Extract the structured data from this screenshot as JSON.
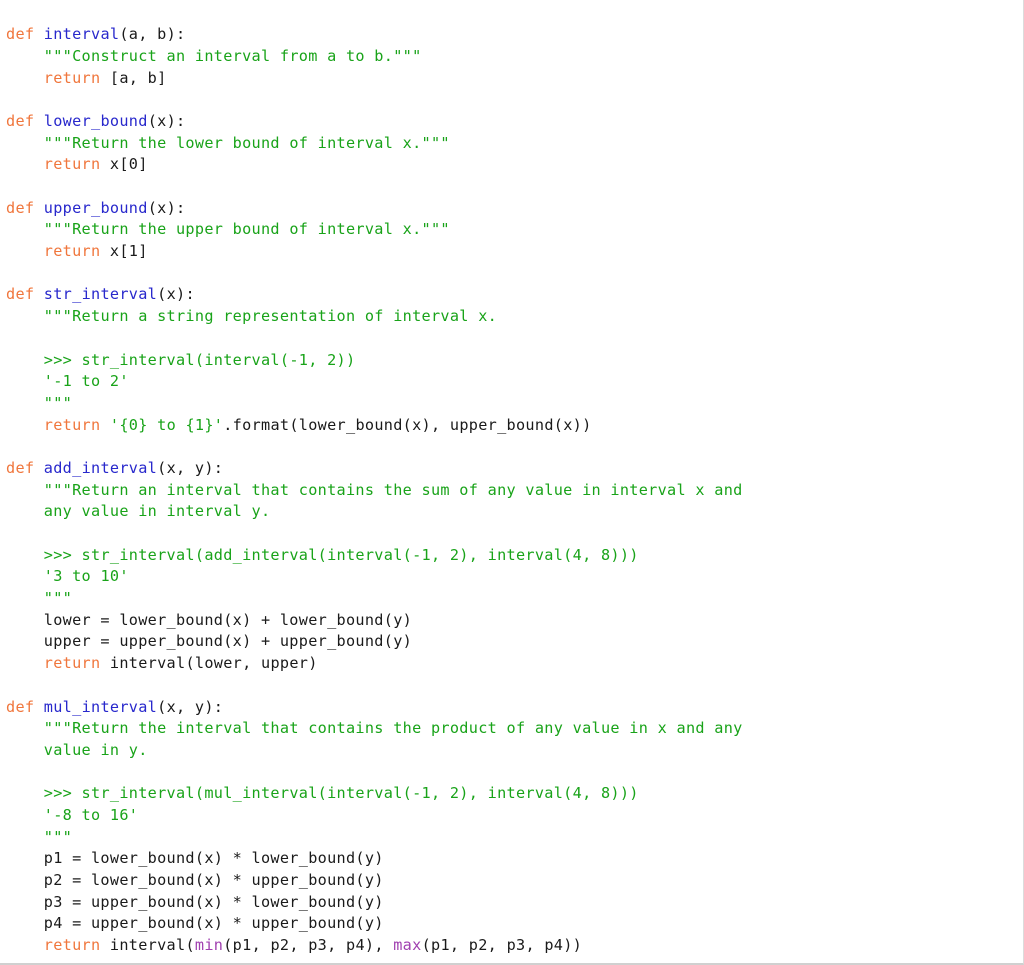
{
  "editor": {
    "language": "python",
    "colors": {
      "background": "#ffffff",
      "keyword": "#f0763c",
      "function_name": "#2828cc",
      "string": "#19a319",
      "builtin": "#a040b0",
      "plain": "#1a1a1a",
      "border": "#dcdcdc"
    },
    "line_count": 44
  },
  "code": {
    "lines": [
      {
        "n": 1,
        "tokens": [
          {
            "t": "kw",
            "s": "def"
          },
          {
            "t": "pl",
            "s": " "
          },
          {
            "t": "fn",
            "s": "interval"
          },
          {
            "t": "pl",
            "s": "(a, b):"
          }
        ]
      },
      {
        "n": 2,
        "tokens": [
          {
            "t": "pl",
            "s": "    "
          },
          {
            "t": "str",
            "s": "\"\"\"Construct an interval from a to b.\"\"\""
          }
        ]
      },
      {
        "n": 3,
        "tokens": [
          {
            "t": "pl",
            "s": "    "
          },
          {
            "t": "kw",
            "s": "return"
          },
          {
            "t": "pl",
            "s": " [a, b]"
          }
        ]
      },
      {
        "n": 4,
        "tokens": []
      },
      {
        "n": 5,
        "tokens": [
          {
            "t": "kw",
            "s": "def"
          },
          {
            "t": "pl",
            "s": " "
          },
          {
            "t": "fn",
            "s": "lower_bound"
          },
          {
            "t": "pl",
            "s": "(x):"
          }
        ]
      },
      {
        "n": 6,
        "tokens": [
          {
            "t": "pl",
            "s": "    "
          },
          {
            "t": "str",
            "s": "\"\"\"Return the lower bound of interval x.\"\"\""
          }
        ]
      },
      {
        "n": 7,
        "tokens": [
          {
            "t": "pl",
            "s": "    "
          },
          {
            "t": "kw",
            "s": "return"
          },
          {
            "t": "pl",
            "s": " x[0]"
          }
        ]
      },
      {
        "n": 8,
        "tokens": []
      },
      {
        "n": 9,
        "tokens": [
          {
            "t": "kw",
            "s": "def"
          },
          {
            "t": "pl",
            "s": " "
          },
          {
            "t": "fn",
            "s": "upper_bound"
          },
          {
            "t": "pl",
            "s": "(x):"
          }
        ]
      },
      {
        "n": 10,
        "tokens": [
          {
            "t": "pl",
            "s": "    "
          },
          {
            "t": "str",
            "s": "\"\"\"Return the upper bound of interval x.\"\"\""
          }
        ]
      },
      {
        "n": 11,
        "tokens": [
          {
            "t": "pl",
            "s": "    "
          },
          {
            "t": "kw",
            "s": "return"
          },
          {
            "t": "pl",
            "s": " x[1]"
          }
        ]
      },
      {
        "n": 12,
        "tokens": []
      },
      {
        "n": 13,
        "tokens": [
          {
            "t": "kw",
            "s": "def"
          },
          {
            "t": "pl",
            "s": " "
          },
          {
            "t": "fn",
            "s": "str_interval"
          },
          {
            "t": "pl",
            "s": "(x):"
          }
        ]
      },
      {
        "n": 14,
        "tokens": [
          {
            "t": "pl",
            "s": "    "
          },
          {
            "t": "str",
            "s": "\"\"\"Return a string representation of interval x."
          }
        ]
      },
      {
        "n": 15,
        "tokens": []
      },
      {
        "n": 16,
        "tokens": [
          {
            "t": "pl",
            "s": "    "
          },
          {
            "t": "str",
            "s": ">>> str_interval(interval(-1, 2))"
          }
        ]
      },
      {
        "n": 17,
        "tokens": [
          {
            "t": "pl",
            "s": "    "
          },
          {
            "t": "str",
            "s": "'-1 to 2'"
          }
        ]
      },
      {
        "n": 18,
        "tokens": [
          {
            "t": "pl",
            "s": "    "
          },
          {
            "t": "str",
            "s": "\"\"\""
          }
        ]
      },
      {
        "n": 19,
        "tokens": [
          {
            "t": "pl",
            "s": "    "
          },
          {
            "t": "kw",
            "s": "return"
          },
          {
            "t": "pl",
            "s": " "
          },
          {
            "t": "str",
            "s": "'{0} to {1}'"
          },
          {
            "t": "pl",
            "s": ".format(lower_bound(x), upper_bound(x))"
          }
        ]
      },
      {
        "n": 20,
        "tokens": []
      },
      {
        "n": 21,
        "tokens": [
          {
            "t": "kw",
            "s": "def"
          },
          {
            "t": "pl",
            "s": " "
          },
          {
            "t": "fn",
            "s": "add_interval"
          },
          {
            "t": "pl",
            "s": "(x, y):"
          }
        ]
      },
      {
        "n": 22,
        "tokens": [
          {
            "t": "pl",
            "s": "    "
          },
          {
            "t": "str",
            "s": "\"\"\"Return an interval that contains the sum of any value in interval x and"
          }
        ]
      },
      {
        "n": 23,
        "tokens": [
          {
            "t": "pl",
            "s": "    "
          },
          {
            "t": "str",
            "s": "any value in interval y."
          }
        ]
      },
      {
        "n": 24,
        "tokens": []
      },
      {
        "n": 25,
        "tokens": [
          {
            "t": "pl",
            "s": "    "
          },
          {
            "t": "str",
            "s": ">>> str_interval(add_interval(interval(-1, 2), interval(4, 8)))"
          }
        ]
      },
      {
        "n": 26,
        "tokens": [
          {
            "t": "pl",
            "s": "    "
          },
          {
            "t": "str",
            "s": "'3 to 10'"
          }
        ]
      },
      {
        "n": 27,
        "tokens": [
          {
            "t": "pl",
            "s": "    "
          },
          {
            "t": "str",
            "s": "\"\"\""
          }
        ]
      },
      {
        "n": 28,
        "tokens": [
          {
            "t": "pl",
            "s": "    lower = lower_bound(x) + lower_bound(y)"
          }
        ]
      },
      {
        "n": 29,
        "tokens": [
          {
            "t": "pl",
            "s": "    upper = upper_bound(x) + upper_bound(y)"
          }
        ]
      },
      {
        "n": 30,
        "tokens": [
          {
            "t": "pl",
            "s": "    "
          },
          {
            "t": "kw",
            "s": "return"
          },
          {
            "t": "pl",
            "s": " interval(lower, upper)"
          }
        ]
      },
      {
        "n": 31,
        "tokens": []
      },
      {
        "n": 32,
        "tokens": [
          {
            "t": "kw",
            "s": "def"
          },
          {
            "t": "pl",
            "s": " "
          },
          {
            "t": "fn",
            "s": "mul_interval"
          },
          {
            "t": "pl",
            "s": "(x, y):"
          }
        ]
      },
      {
        "n": 33,
        "tokens": [
          {
            "t": "pl",
            "s": "    "
          },
          {
            "t": "str",
            "s": "\"\"\"Return the interval that contains the product of any value in x and any"
          }
        ]
      },
      {
        "n": 34,
        "tokens": [
          {
            "t": "pl",
            "s": "    "
          },
          {
            "t": "str",
            "s": "value in y."
          }
        ]
      },
      {
        "n": 35,
        "tokens": []
      },
      {
        "n": 36,
        "tokens": [
          {
            "t": "pl",
            "s": "    "
          },
          {
            "t": "str",
            "s": ">>> str_interval(mul_interval(interval(-1, 2), interval(4, 8)))"
          }
        ]
      },
      {
        "n": 37,
        "tokens": [
          {
            "t": "pl",
            "s": "    "
          },
          {
            "t": "str",
            "s": "'-8 to 16'"
          }
        ]
      },
      {
        "n": 38,
        "tokens": [
          {
            "t": "pl",
            "s": "    "
          },
          {
            "t": "str",
            "s": "\"\"\""
          }
        ]
      },
      {
        "n": 39,
        "tokens": [
          {
            "t": "pl",
            "s": "    p1 = lower_bound(x) * lower_bound(y)"
          }
        ]
      },
      {
        "n": 40,
        "tokens": [
          {
            "t": "pl",
            "s": "    p2 = lower_bound(x) * upper_bound(y)"
          }
        ]
      },
      {
        "n": 41,
        "tokens": [
          {
            "t": "pl",
            "s": "    p3 = upper_bound(x) * lower_bound(y)"
          }
        ]
      },
      {
        "n": 42,
        "tokens": [
          {
            "t": "pl",
            "s": "    p4 = upper_bound(x) * upper_bound(y)"
          }
        ]
      },
      {
        "n": 43,
        "tokens": [
          {
            "t": "pl",
            "s": "    "
          },
          {
            "t": "kw",
            "s": "return"
          },
          {
            "t": "pl",
            "s": " interval("
          },
          {
            "t": "bi",
            "s": "min"
          },
          {
            "t": "pl",
            "s": "(p1, p2, p3, p4), "
          },
          {
            "t": "bi",
            "s": "max"
          },
          {
            "t": "pl",
            "s": "(p1, p2, p3, p4))"
          }
        ]
      }
    ]
  }
}
